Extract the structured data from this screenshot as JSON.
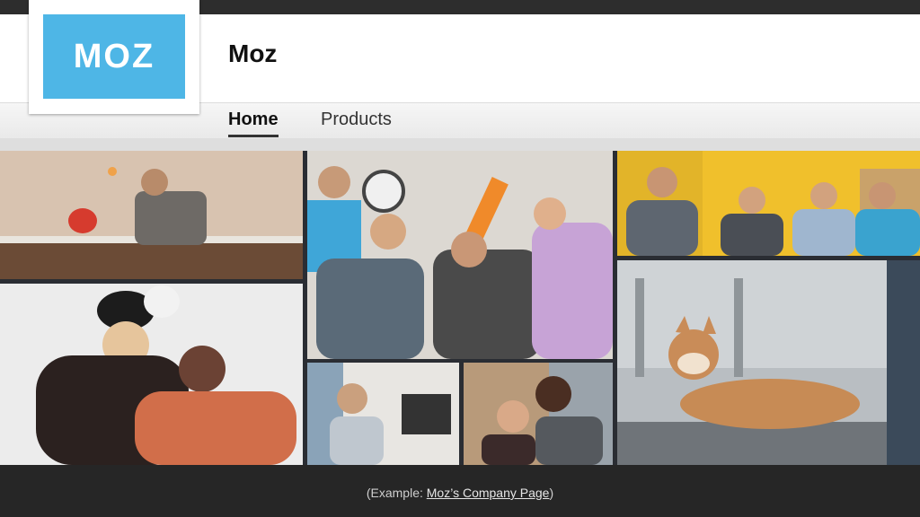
{
  "company": {
    "logo_text": "MOZ",
    "name": "Moz"
  },
  "nav": {
    "tabs": [
      {
        "label": "Home",
        "active": true
      },
      {
        "label": "Products",
        "active": false
      }
    ]
  },
  "footer": {
    "caption_prefix": "(Example: ",
    "link_text": "Moz’s Company Page",
    "caption_suffix": ")"
  },
  "colors": {
    "brand": "#4eb6e6"
  },
  "photos": [
    {
      "id": "ping-pong",
      "label": ""
    },
    {
      "id": "panda-friends",
      "label": ""
    },
    {
      "id": "team-toys",
      "label": ""
    },
    {
      "id": "office-worker",
      "label": ""
    },
    {
      "id": "couple",
      "label": ""
    },
    {
      "id": "meeting",
      "label": ""
    },
    {
      "id": "dog",
      "label": ""
    }
  ]
}
